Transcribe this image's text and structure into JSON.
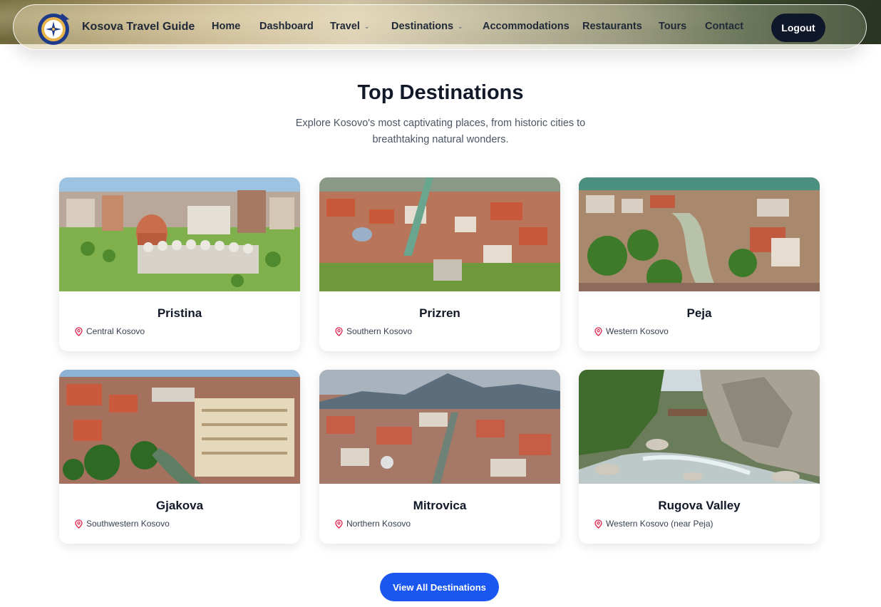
{
  "brand": {
    "name": "Kosova Travel Guide"
  },
  "nav": {
    "items": [
      {
        "label": "Home",
        "dropdown": false
      },
      {
        "label": "Dashboard",
        "dropdown": false
      },
      {
        "label": "Travel",
        "dropdown": true
      },
      {
        "label": "Destinations",
        "dropdown": true
      },
      {
        "label": "Accommodations",
        "dropdown": false
      },
      {
        "label": "Restaurants",
        "dropdown": false
      },
      {
        "label": "Tours",
        "dropdown": false
      },
      {
        "label": "Contact",
        "dropdown": false
      }
    ],
    "logout_label": "Logout"
  },
  "section": {
    "title": "Top Destinations",
    "subtitle": "Explore Kosovo's most captivating places, from historic cities to breathtaking natural wonders."
  },
  "destinations": [
    {
      "name": "Pristina",
      "region": "Central Kosovo",
      "icon": "map-pin-icon"
    },
    {
      "name": "Prizren",
      "region": "Southern Kosovo",
      "icon": "map-pin-icon"
    },
    {
      "name": "Peja",
      "region": "Western Kosovo",
      "icon": "map-pin-icon"
    },
    {
      "name": "Gjakova",
      "region": "Southwestern Kosovo",
      "icon": "map-pin-icon"
    },
    {
      "name": "Mitrovica",
      "region": "Northern Kosovo",
      "icon": "map-pin-icon"
    },
    {
      "name": "Rugova Valley",
      "region": "Western Kosovo (near Peja)",
      "icon": "map-pin-icon"
    }
  ],
  "cta": {
    "label": "View All Destinations"
  },
  "colors": {
    "accent": "#1a56f0",
    "dark_button": "#0f172a",
    "pin": "#e11d48"
  }
}
